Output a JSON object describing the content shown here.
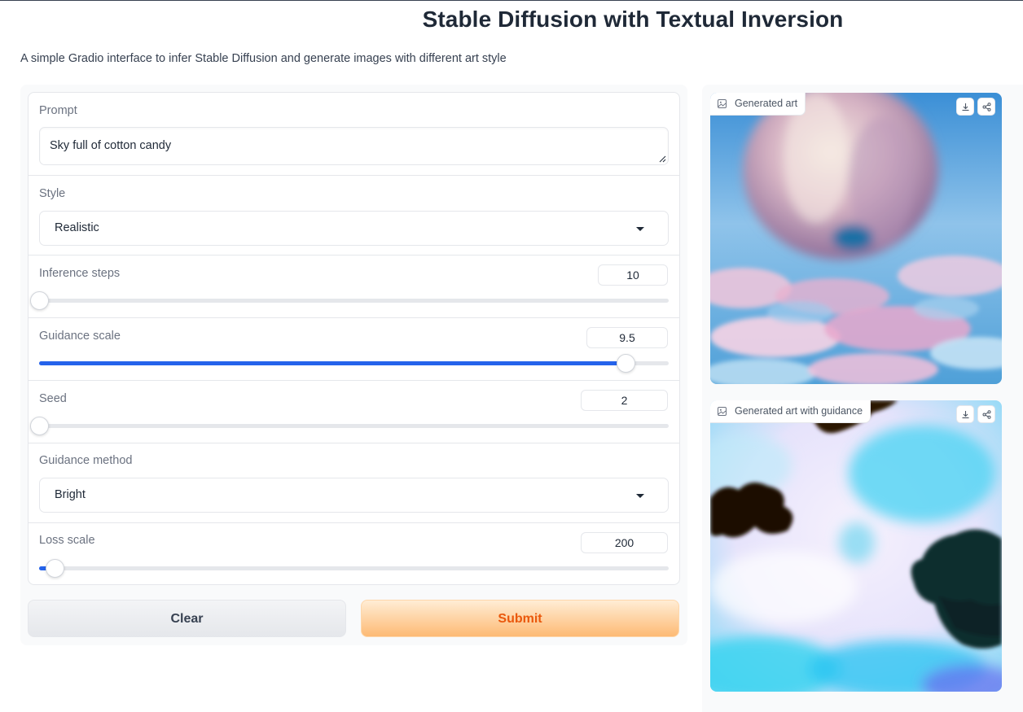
{
  "header": {
    "title": "Stable Diffusion with Textual Inversion",
    "subtitle": "A simple Gradio interface to infer Stable Diffusion and generate images with different art style"
  },
  "form": {
    "prompt": {
      "label": "Prompt",
      "value": "Sky full of cotton candy"
    },
    "style": {
      "label": "Style",
      "selected": "Realistic"
    },
    "inference_steps": {
      "label": "Inference steps",
      "value": "10",
      "fraction": 0.0
    },
    "guidance_scale": {
      "label": "Guidance scale",
      "value": "9.5",
      "fraction": 0.931
    },
    "seed": {
      "label": "Seed",
      "value": "2",
      "fraction": 0.0
    },
    "guidance_method": {
      "label": "Guidance method",
      "selected": "Bright"
    },
    "loss_scale": {
      "label": "Loss scale",
      "value": "200",
      "fraction": 0.0245
    }
  },
  "buttons": {
    "clear": "Clear",
    "submit": "Submit"
  },
  "outputs": {
    "image1": {
      "label": "Generated art"
    },
    "image2": {
      "label": "Generated art with guidance"
    }
  },
  "icons": [
    "image-icon",
    "download-icon",
    "share-icon",
    "resize-grip-icon",
    "chevron-down-icon"
  ],
  "colors": {
    "accent": "#2563eb",
    "submit_text": "#ea580c",
    "submit_bg": "#fdba74"
  }
}
